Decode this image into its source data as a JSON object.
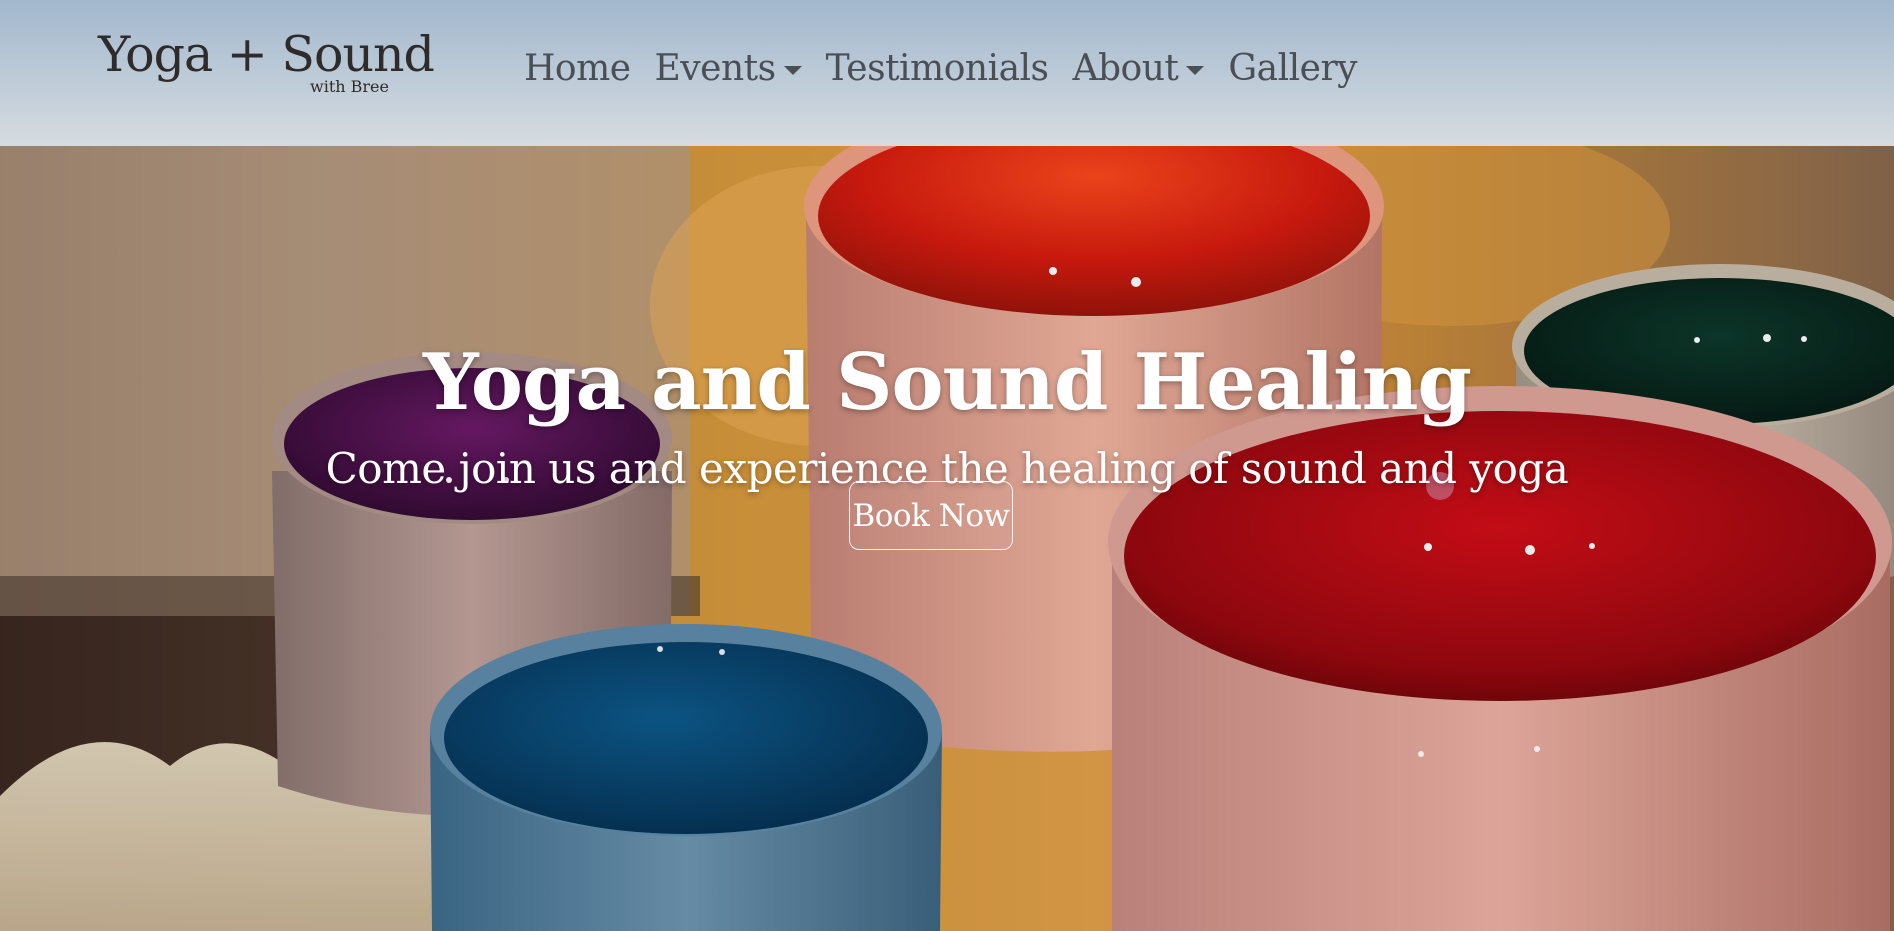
{
  "brand": {
    "logo_main": "Yoga + Sound",
    "logo_sub": "with Bree"
  },
  "nav": {
    "items": [
      {
        "label": "Home",
        "has_dropdown": false
      },
      {
        "label": "Events",
        "has_dropdown": true
      },
      {
        "label": "Testimonials",
        "has_dropdown": false
      },
      {
        "label": "About",
        "has_dropdown": true
      },
      {
        "label": "Gallery",
        "has_dropdown": false
      }
    ]
  },
  "hero": {
    "title": "Yoga and Sound Healing",
    "subtitle": "Come join us and experience the healing of sound and yoga",
    "cta_label": "Book Now",
    "image_subject": "crystal singing bowls"
  },
  "colors": {
    "nav_text": "#4a4e55",
    "logo_text": "#2e2b2a",
    "hero_text": "#ffffff"
  }
}
